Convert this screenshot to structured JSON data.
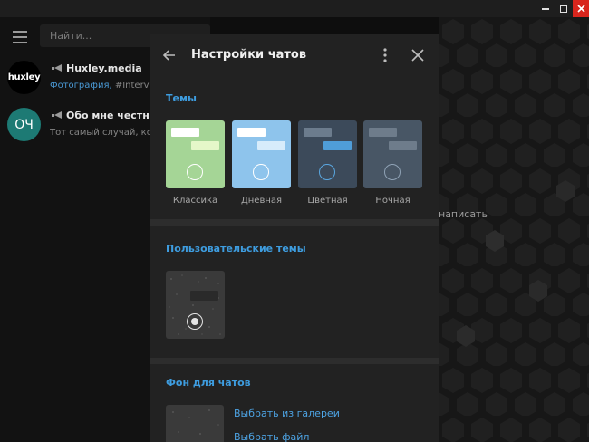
{
  "window": {
    "minimize_icon": "minimize-icon",
    "maximize_icon": "maximize-icon",
    "close_icon": "close-icon",
    "close_color": "#d8251d"
  },
  "sidebar": {
    "search": {
      "placeholder": "Найти..."
    },
    "chats": [
      {
        "avatar_text": "huxley",
        "title": "Huxley.media",
        "preview_accent": "Фотография,",
        "preview_text": " #Interview"
      },
      {
        "avatar_text": "ОЧ",
        "title": "Обо мне честно.",
        "preview_text": "Тот самый случай, ког"
      }
    ]
  },
  "background_hint": "написать",
  "settings": {
    "title": "Настройки чатов",
    "sections": {
      "themes": "Темы",
      "custom_themes": "Пользовательские темы",
      "chat_background": "Фон для чатов"
    },
    "themes": [
      {
        "label": "Классика",
        "bg": "#a5d596",
        "bubble1": "#ffffff",
        "bubble2": "#e5f7c9",
        "radio": "#ffffff"
      },
      {
        "label": "Дневная",
        "bg": "#8ec4ec",
        "bubble1": "#ffffff",
        "bubble2": "#d7ecfb",
        "radio": "#ffffff"
      },
      {
        "label": "Цветная",
        "bg": "#3c4a5a",
        "bubble1": "#6c7c8d",
        "bubble2": "#4f9dd8",
        "radio": "#5aa7e0"
      },
      {
        "label": "Ночная",
        "bg": "#485665",
        "bubble1": "#6e7c8b",
        "bubble2": "#6e7c8b",
        "radio": "#8fa2b5"
      }
    ],
    "links": {
      "gallery": "Выбрать из галереи",
      "file": "Выбрать файл"
    },
    "accent": "#3e9de0"
  }
}
